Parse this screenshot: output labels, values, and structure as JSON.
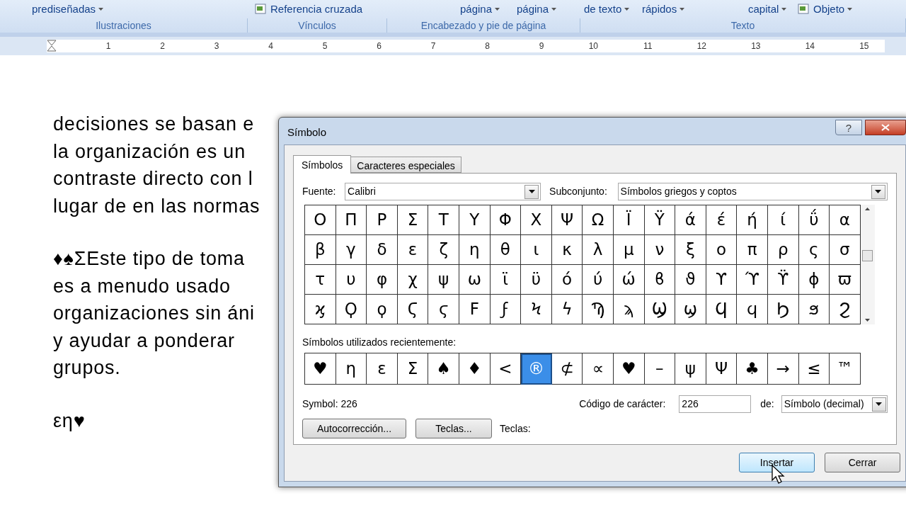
{
  "ribbon": {
    "items": [
      {
        "label": "prediseñadas",
        "dropdown": true,
        "kind": "text"
      },
      {
        "label": "Referencia cruzada",
        "dropdown": false,
        "kind": "icon"
      },
      {
        "label": "página",
        "dropdown": true,
        "kind": "text"
      },
      {
        "label": "página",
        "dropdown": true,
        "kind": "text"
      },
      {
        "label": "de texto",
        "dropdown": true,
        "kind": "text"
      },
      {
        "label": "rápidos",
        "dropdown": true,
        "kind": "text"
      },
      {
        "label": "capital",
        "dropdown": true,
        "kind": "text"
      },
      {
        "label": "Objeto",
        "dropdown": true,
        "kind": "icon"
      }
    ],
    "groups": [
      "Ilustraciones",
      "Vínculos",
      "Encabezado y pie de página",
      "Texto"
    ]
  },
  "ruler": {
    "ticks": [
      "1",
      "2",
      "3",
      "4",
      "5",
      "6",
      "7",
      "8",
      "9",
      "10",
      "11",
      "12",
      "13",
      "14",
      "15"
    ]
  },
  "document": {
    "paragraphs": [
      [
        "decisiones se basan e",
        "la organización es un",
        "contraste directo con l",
        "lugar de en las normas"
      ],
      [
        "♦♠ΣEste tipo de toma",
        "es a menudo usado",
        "organizaciones sin áni",
        "y ayudar a ponderar",
        "grupos."
      ],
      [
        "εη♥"
      ]
    ]
  },
  "dialog": {
    "title": "Símbolo",
    "help": "?",
    "tabs": [
      {
        "label": "Símbolos",
        "selected": true
      },
      {
        "label": "Caracteres especiales",
        "selected": false
      }
    ],
    "font": {
      "label": "Fuente:",
      "value": "Calibri"
    },
    "subset": {
      "label": "Subconjunto:",
      "value": "Símbolos griegos y coptos"
    },
    "symbols": [
      "Ο",
      "Π",
      "Ρ",
      "Σ",
      "Τ",
      "Υ",
      "Φ",
      "Χ",
      "Ψ",
      "Ω",
      "Ϊ",
      "Ϋ",
      "ά",
      "έ",
      "ή",
      "ί",
      "ΰ",
      "α",
      "β",
      "γ",
      "δ",
      "ε",
      "ζ",
      "η",
      "θ",
      "ι",
      "κ",
      "λ",
      "μ",
      "ν",
      "ξ",
      "ο",
      "π",
      "ρ",
      "ς",
      "σ",
      "τ",
      "υ",
      "φ",
      "χ",
      "ψ",
      "ω",
      "ϊ",
      "ϋ",
      "ό",
      "ύ",
      "ώ",
      "ϐ",
      "ϑ",
      "ϒ",
      "ϓ",
      "ϔ",
      "ϕ",
      "ϖ",
      "ϗ",
      "Ϙ",
      "ϙ",
      "Ϛ",
      "ϛ",
      "Ϝ",
      "ϝ",
      "Ϟ",
      "ϟ",
      "Ϡ",
      "ϡ",
      "Ϣ",
      "ϣ",
      "Ϥ",
      "ϥ",
      "Ϧ",
      "ϧ",
      "Ϩ"
    ],
    "recent_label": "Símbolos utilizados recientemente:",
    "recent": [
      {
        "char": "♥",
        "selected": false
      },
      {
        "char": "η",
        "selected": false
      },
      {
        "char": "ε",
        "selected": false
      },
      {
        "char": "Σ",
        "selected": false
      },
      {
        "char": "♠",
        "selected": false
      },
      {
        "char": "♦",
        "selected": false
      },
      {
        "char": "<",
        "selected": false
      },
      {
        "char": "®",
        "selected": true
      },
      {
        "char": "⊄",
        "selected": false
      },
      {
        "char": "∝",
        "selected": false
      },
      {
        "char": "♥",
        "selected": false
      },
      {
        "char": "–",
        "selected": false
      },
      {
        "char": "ψ",
        "selected": false
      },
      {
        "char": "Ψ",
        "selected": false
      },
      {
        "char": "♣",
        "selected": false
      },
      {
        "char": "→",
        "selected": false
      },
      {
        "char": "≤",
        "selected": false
      },
      {
        "char": "™",
        "selected": false
      }
    ],
    "symbol_info": "Symbol: 226",
    "char_code": {
      "label": "Código de carácter:",
      "value": "226"
    },
    "from": {
      "label": "de:",
      "value": "Símbolo (decimal)"
    },
    "buttons": [
      "Autocorrección...",
      "Teclas..."
    ],
    "keys_label": "Teclas:",
    "actions": [
      {
        "label": "Insertar",
        "default": true
      },
      {
        "label": "Cerrar",
        "default": false
      }
    ]
  }
}
